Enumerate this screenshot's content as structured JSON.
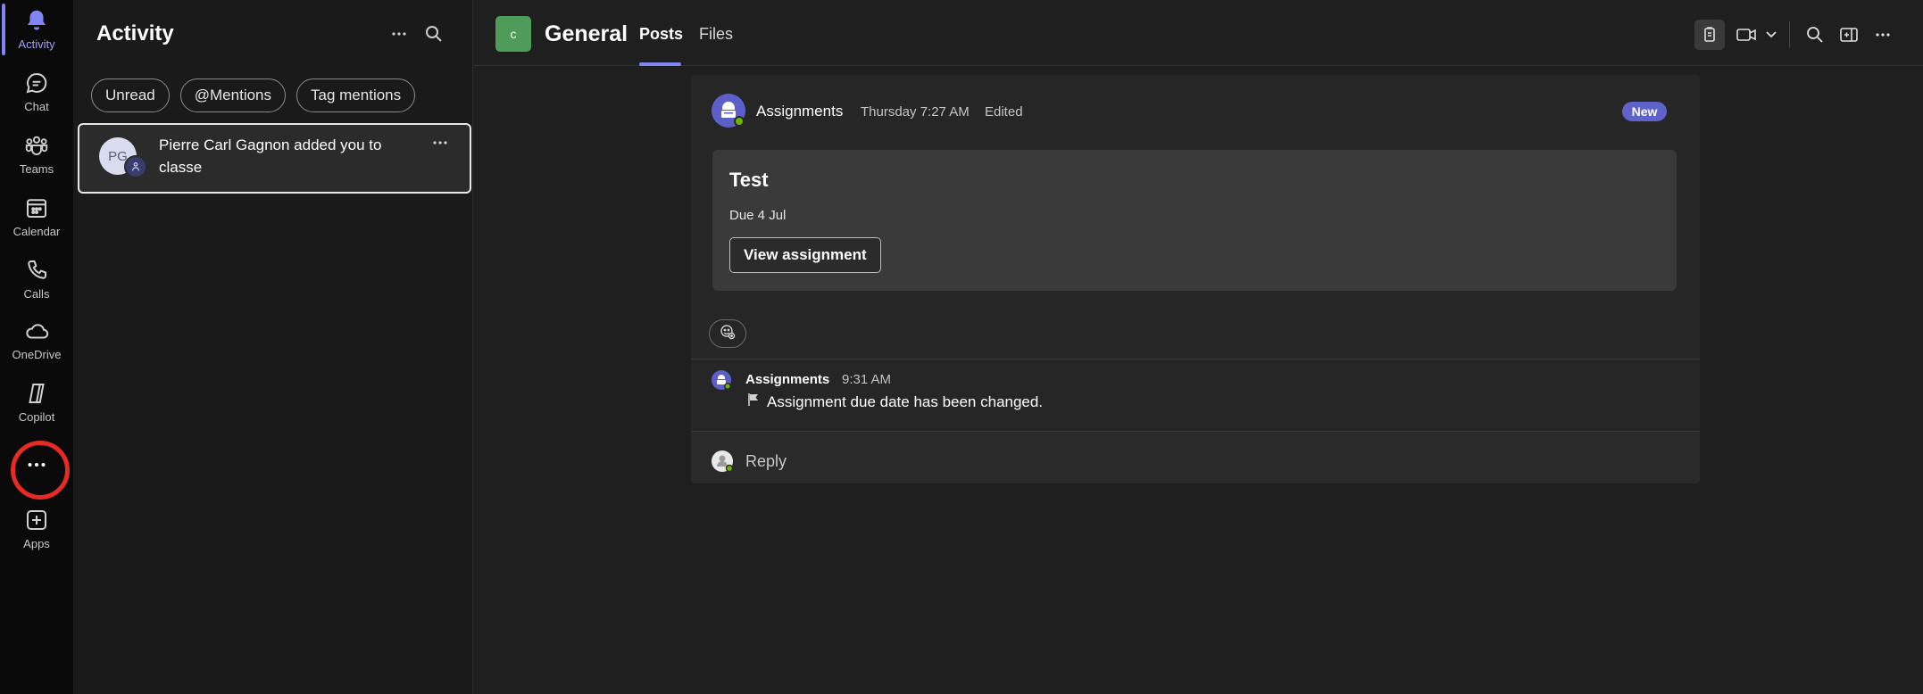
{
  "rail": {
    "items": [
      {
        "label": "Activity",
        "icon": "bell-icon"
      },
      {
        "label": "Chat",
        "icon": "chat-icon"
      },
      {
        "label": "Teams",
        "icon": "teams-icon"
      },
      {
        "label": "Calendar",
        "icon": "calendar-icon"
      },
      {
        "label": "Calls",
        "icon": "phone-icon"
      },
      {
        "label": "OneDrive",
        "icon": "cloud-icon"
      },
      {
        "label": "Copilot",
        "icon": "copilot-icon"
      },
      {
        "label": "",
        "icon": "more-horizontal-icon"
      },
      {
        "label": "Apps",
        "icon": "add-apps-icon"
      }
    ]
  },
  "activity": {
    "title": "Activity",
    "filters": [
      "Unread",
      "@Mentions",
      "Tag mentions"
    ],
    "notification": {
      "avatar_initials": "PG",
      "text": "Pierre Carl Gagnon added you to classe"
    }
  },
  "header": {
    "team_badge": "c",
    "channel": "General",
    "tabs": [
      "Posts",
      "Files"
    ],
    "active_tab": "Posts"
  },
  "post": {
    "author": "Assignments",
    "time": "Thursday 7:27 AM",
    "edited": "Edited",
    "badge": "New",
    "card": {
      "title": "Test",
      "due": "Due 4 Jul",
      "button": "View assignment"
    }
  },
  "reply": {
    "author": "Assignments",
    "time": "9:31 AM",
    "text": "Assignment due date has been changed."
  },
  "reply_box": {
    "label": "Reply"
  },
  "colors": {
    "accent": "#7f85f5",
    "rail_bg": "#0a0a0a",
    "pane_bg": "#1a1a1a",
    "main_bg": "#1f1f1f",
    "team_green": "#4f9c5a",
    "new_badge": "#5f63c9",
    "highlight_circle": "#e52b23"
  }
}
